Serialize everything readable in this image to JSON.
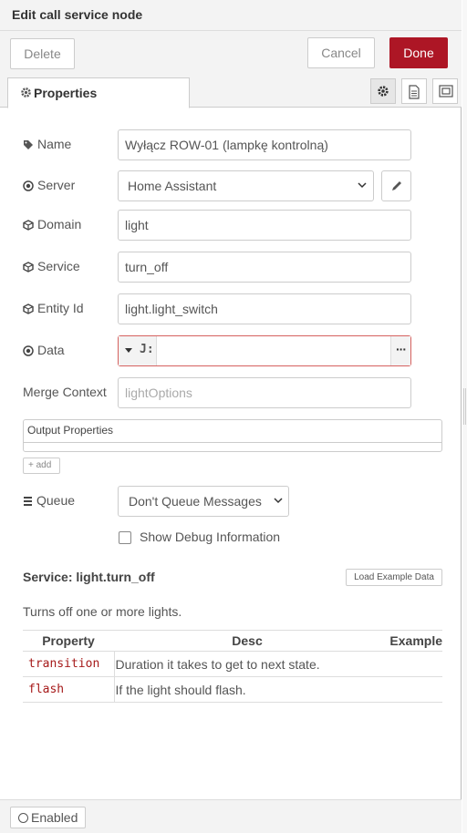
{
  "window": {
    "title": "Edit call service node"
  },
  "toolbar": {
    "delete_label": "Delete",
    "cancel_label": "Cancel",
    "done_label": "Done"
  },
  "tabs": {
    "properties_label": "Properties"
  },
  "form": {
    "name_label": "Name",
    "name_value": "Wyłącz ROW-01 (lampkę kontrolną)",
    "server_label": "Server",
    "server_value": "Home Assistant",
    "domain_label": "Domain",
    "domain_value": "light",
    "service_label": "Service",
    "service_value": "turn_off",
    "entity_label": "Entity Id",
    "entity_value": "light.light_switch",
    "data_label": "Data",
    "data_type_glyph": "J:",
    "data_more": "···",
    "merge_label": "Merge Context",
    "merge_placeholder": "lightOptions",
    "output_label": "Output Properties",
    "add_label": "add",
    "queue_label": "Queue",
    "queue_value": "Don't Queue Messages",
    "debug_label": "Show Debug Information"
  },
  "service_info": {
    "title": "Service: light.turn_off",
    "load_example_label": "Load Example Data",
    "description": "Turns off one or more lights.",
    "columns": [
      "Property",
      "Desc",
      "Example"
    ],
    "rows": [
      {
        "property": "transition",
        "desc": "Duration it takes to get to next state.",
        "example": ""
      },
      {
        "property": "flash",
        "desc": "If the light should flash.",
        "example": ""
      }
    ]
  },
  "footer": {
    "enabled_label": "Enabled"
  },
  "colors": {
    "done_bg": "#ad1625",
    "error_border": "#d6615f",
    "code_text": "#a61a1a"
  }
}
